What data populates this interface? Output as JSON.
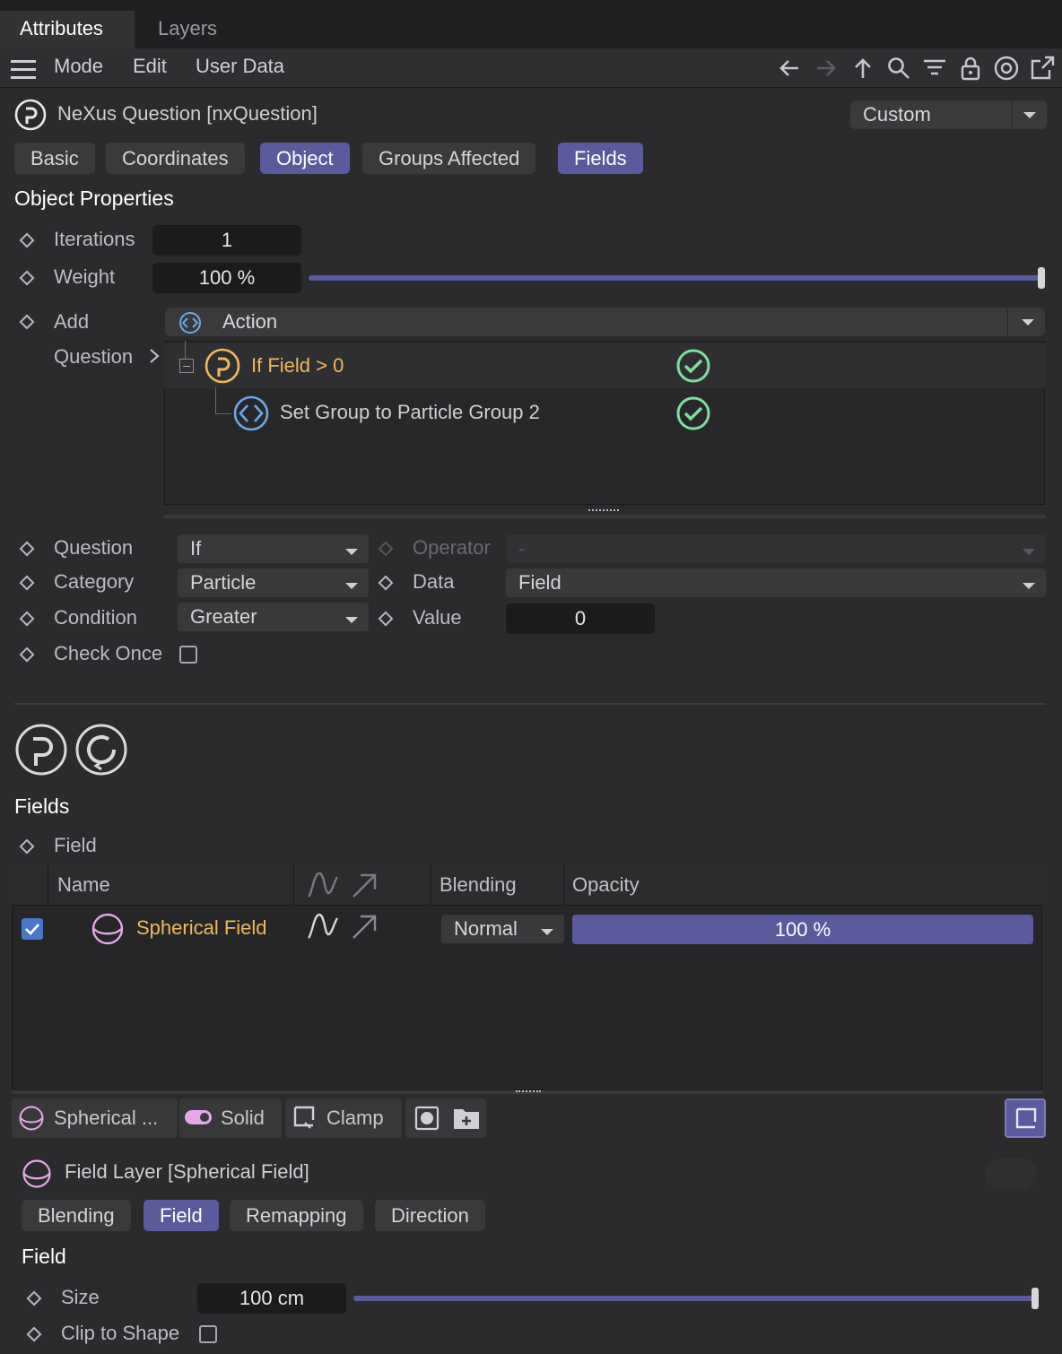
{
  "tabs": [
    "Attributes",
    "Layers"
  ],
  "menu": [
    "Mode",
    "Edit",
    "User Data"
  ],
  "toolbar_icons": [
    "back-arrow-icon",
    "forward-arrow-icon",
    "up-arrow-icon",
    "search-icon",
    "filter-icon",
    "lock-icon",
    "target-icon",
    "new-window-icon"
  ],
  "object": {
    "title": "NeXus Question [nxQuestion]",
    "preset": "Custom"
  },
  "object_tabs": [
    {
      "label": "Basic",
      "active": false
    },
    {
      "label": "Coordinates",
      "active": false
    },
    {
      "label": "Object",
      "active": true
    },
    {
      "label": "Groups Affected",
      "active": false
    },
    {
      "label": "Fields",
      "active": true
    }
  ],
  "object_properties": {
    "section_title": "Object Properties",
    "iterations_label": "Iterations",
    "iterations_value": "1",
    "weight_label": "Weight",
    "weight_value": "100 %",
    "weight_fraction": 1.0,
    "add_label": "Add",
    "add_value": "Action",
    "question_label": "Question",
    "tree": [
      {
        "label": "If Field > 0",
        "type": "question",
        "enabled": true
      },
      {
        "label": "Set Group to Particle Group 2",
        "type": "action",
        "enabled": true
      }
    ]
  },
  "question_settings": {
    "question_label": "Question",
    "question_value": "If",
    "operator_label": "Operator",
    "operator_value": "-",
    "category_label": "Category",
    "category_value": "Particle",
    "data_label": "Data",
    "data_value": "Field",
    "condition_label": "Condition",
    "condition_value": "Greater",
    "value_label": "Value",
    "value_value": "0",
    "check_once_label": "Check Once",
    "check_once_checked": false
  },
  "fields": {
    "section_title": "Fields",
    "field_label": "Field",
    "columns": [
      "Name",
      "Blending",
      "Opacity"
    ],
    "rows": [
      {
        "enabled": true,
        "name": "Spherical Field",
        "blending": "Normal",
        "opacity": "100 %",
        "opacity_fraction": 1.0
      }
    ]
  },
  "bottom_toolbar": {
    "field_name": "Spherical ...",
    "solid": "Solid",
    "clamp": "Clamp"
  },
  "field_layer": {
    "title": "Field Layer [Spherical Field]",
    "tabs": [
      {
        "label": "Blending",
        "active": false
      },
      {
        "label": "Field",
        "active": true
      },
      {
        "label": "Remapping",
        "active": false
      },
      {
        "label": "Direction",
        "active": false
      }
    ],
    "section_title": "Field",
    "size_label": "Size",
    "size_value": "100 cm",
    "size_fraction": 1.0,
    "clip_label": "Clip to Shape",
    "clip_checked": false
  },
  "colors": {
    "accent": "#5a5a9c",
    "highlight_text": "#f0b85a",
    "check_green": "#7ee0a0",
    "pink": "#e6a8e8",
    "blue_icon": "#6aa8e8"
  }
}
